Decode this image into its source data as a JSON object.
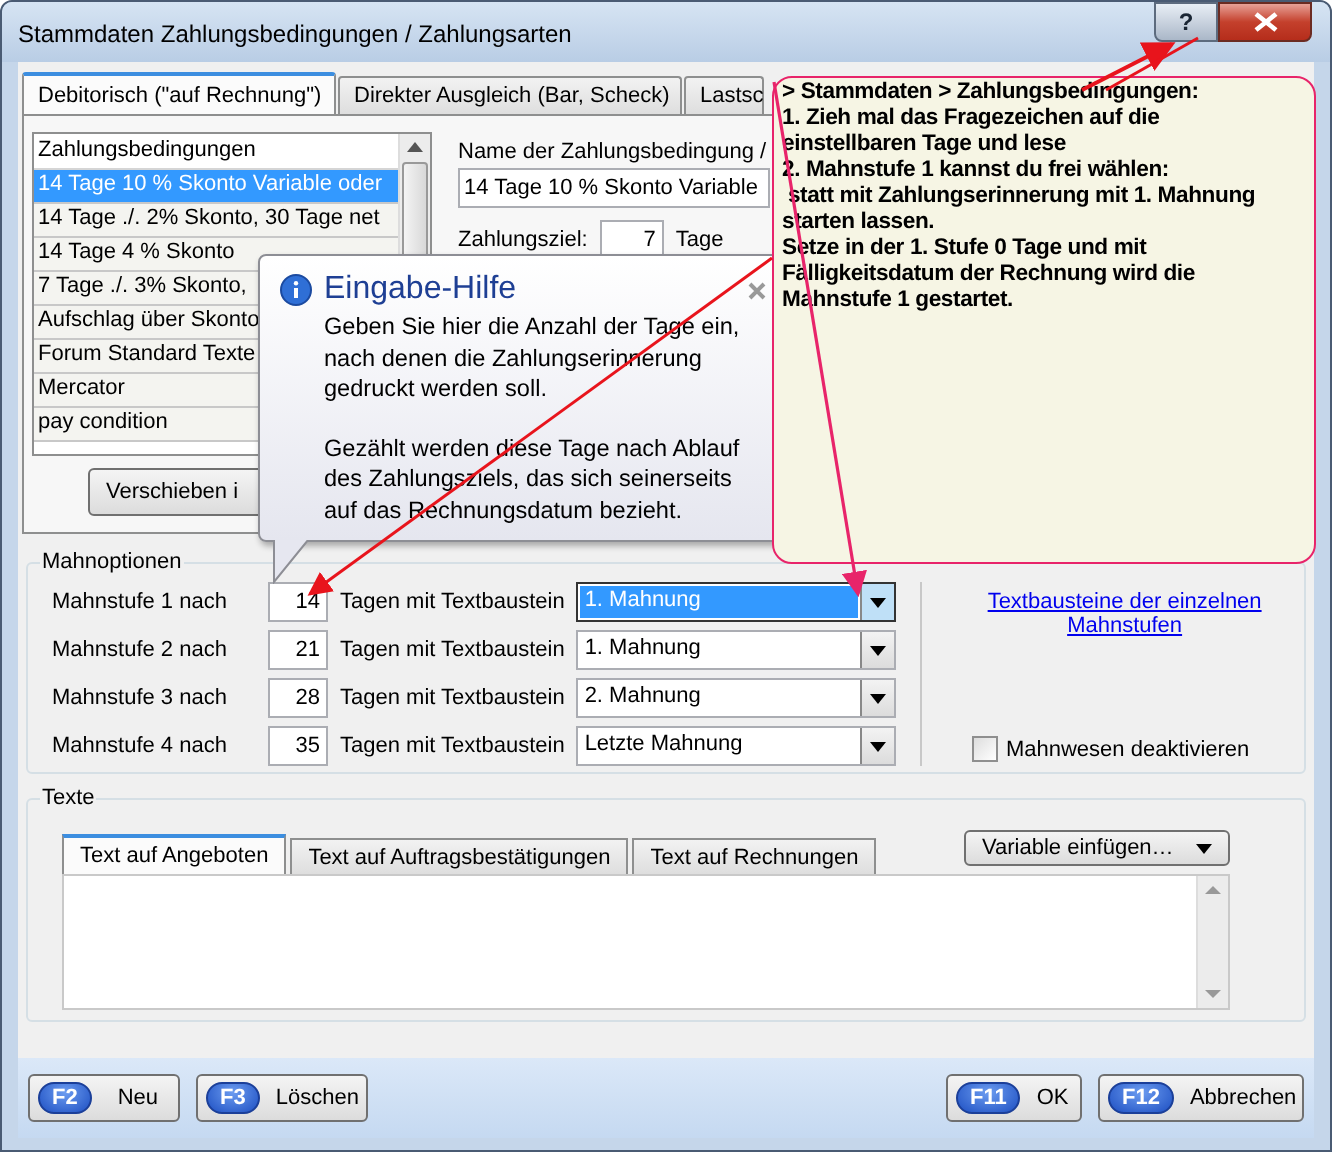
{
  "window": {
    "title": "Stammdaten Zahlungsbedingungen / Zahlungsarten",
    "help_label": "?"
  },
  "tabs": [
    {
      "label": "Debitorisch (\"auf Rechnung\")",
      "selected": true
    },
    {
      "label": "Direkter Ausgleich (Bar, Scheck)",
      "selected": false
    },
    {
      "label": "Lastsc",
      "selected": false
    }
  ],
  "conditions_list": {
    "header": "Zahlungsbedingungen",
    "items": [
      {
        "label": "14 Tage 10 % Skonto Variable oder",
        "selected": true
      },
      {
        "label": "14 Tage ./. 2% Skonto, 30 Tage net",
        "selected": false
      },
      {
        "label": "14 Tage 4 % Skonto",
        "selected": false
      },
      {
        "label": "7 Tage ./. 3% Skonto,",
        "selected": false
      },
      {
        "label": "Aufschlag über Skonto",
        "selected": false
      },
      {
        "label": "Forum Standard Texte",
        "selected": false
      },
      {
        "label": "Mercator",
        "selected": false
      },
      {
        "label": "pay condition",
        "selected": false
      }
    ]
  },
  "move_button": "Verschieben i",
  "name_field": {
    "label": "Name der Zahlungsbedingung /",
    "value": "14 Tage 10 % Skonto Variable"
  },
  "payment_term": {
    "label": "Zahlungsziel:",
    "value": "7",
    "unit": "Tage"
  },
  "dunning": {
    "title": "Mahnoptionen",
    "levels": [
      {
        "label": "Mahnstufe 1 nach",
        "days": "14",
        "middle": "Tagen mit Textbaustein",
        "template": "1. Mahnung",
        "selected": true
      },
      {
        "label": "Mahnstufe 2 nach",
        "days": "21",
        "middle": "Tagen mit Textbaustein",
        "template": "1. Mahnung",
        "selected": false
      },
      {
        "label": "Mahnstufe 3 nach",
        "days": "28",
        "middle": "Tagen mit Textbaustein",
        "template": "2. Mahnung",
        "selected": false
      },
      {
        "label": "Mahnstufe 4 nach",
        "days": "35",
        "middle": "Tagen mit Textbaustein",
        "template": "Letzte Mahnung",
        "selected": false
      }
    ],
    "link": "Textbausteine der einzelnen Mahnstufen",
    "deactivate": {
      "label": "Mahnwesen deaktivieren",
      "checked": false
    }
  },
  "texts": {
    "title": "Texte",
    "tabs": [
      {
        "label": "Text auf Angeboten",
        "selected": true
      },
      {
        "label": "Text auf Auftragsbestätigungen",
        "selected": false
      },
      {
        "label": "Text auf Rechnungen",
        "selected": false
      }
    ],
    "insert_button": "Variable einfügen…"
  },
  "footer": {
    "left": [
      {
        "key": "F2",
        "label": "Neu"
      },
      {
        "key": "F3",
        "label": "Löschen"
      }
    ],
    "right": [
      {
        "key": "F11",
        "label": "OK"
      },
      {
        "key": "F12",
        "label": "Abbrechen"
      }
    ]
  },
  "balloon": {
    "title": "Eingabe-Hilfe",
    "paragraphs": [
      "Geben Sie hier die Anzahl der Tage ein,\nnach denen die Zahlungserinnerung\ngedruckt werden soll.",
      "Gezählt werden diese Tage nach Ablauf\ndes Zahlungsziels, das sich seinerseits\nauf das Rechnungsdatum bezieht."
    ]
  },
  "note": {
    "text": "> Stammdaten > Zahlungsbedingungen:\n1. Zieh mal das Fragezeichen auf die\neinstellbaren Tage und lese\n2. Mahnstufe 1 kannst du frei wählen:\n statt mit Zahlungserinnerung mit 1. Mahnung\nstarten lassen.\nSetze in der 1. Stufe 0 Tage und mit\nFälligkeitsdatum der Rechnung wird die\nMahnstufe 1 gestartet."
  }
}
